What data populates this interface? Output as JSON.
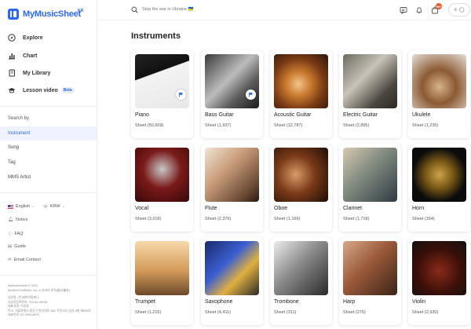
{
  "brand": {
    "name": "MyMusicSheet",
    "region": "KR"
  },
  "nav": [
    {
      "label": "Explore",
      "icon": "compass-icon"
    },
    {
      "label": "Chart",
      "icon": "chart-icon"
    },
    {
      "label": "My Library",
      "icon": "library-icon"
    },
    {
      "label": "Lesson video",
      "icon": "graduation-cap-icon",
      "badge": "Beta"
    }
  ],
  "browse": {
    "heading": "Search by",
    "items": [
      {
        "label": "Instrument",
        "active": true
      },
      {
        "label": "Song",
        "active": false
      },
      {
        "label": "Tag",
        "active": false
      },
      {
        "label": "MMS Artist",
        "active": false
      }
    ]
  },
  "locale": {
    "language": "English",
    "currency": "KRW"
  },
  "links": [
    {
      "label": "Notice",
      "icon": "bell-icon"
    },
    {
      "label": "FAQ",
      "icon": "question-icon"
    },
    {
      "label": "Guide",
      "icon": "book-icon"
    },
    {
      "label": "Email Contact",
      "icon": "envelope-icon"
    }
  ],
  "footer": {
    "lines": [
      "MyMusicSheet © 2023",
      "MAPIACOMPANY, Inc. & 코리아 뮤직(株式會社)",
      "",
      "상호명: (주)마피아컴퍼니",
      "사업자등록번호: 752-81-00236",
      "대표자명: 이승원",
      "주소: 서울특별시 용산구 한강대로 366, 트윈시티 남산 6층 제605호",
      "대표번호: 02-2399-8870"
    ]
  },
  "header": {
    "search_placeholder": "Stop the war in Ukraine 🇺🇦",
    "cart_count": "99+"
  },
  "page": {
    "title": "Instruments"
  },
  "colors": {
    "accent": "#2b67f6",
    "active_bg": "#eef3ff",
    "badge": "#f05a28"
  },
  "instruments": [
    {
      "name": "Piano",
      "count": "Sheet (50,609)",
      "pinned": true
    },
    {
      "name": "Bass Guitar",
      "count": "Sheet (1,937)",
      "pinned": true
    },
    {
      "name": "Acoustic Guitar",
      "count": "Sheet (12,787)",
      "pinned": false
    },
    {
      "name": "Electric Guitar",
      "count": "Sheet (2,895)",
      "pinned": false
    },
    {
      "name": "Ukulele",
      "count": "Sheet (1,235)",
      "pinned": false
    },
    {
      "name": "Vocal",
      "count": "Sheet (3,018)",
      "pinned": false
    },
    {
      "name": "Flute",
      "count": "Sheet (2,376)",
      "pinned": false
    },
    {
      "name": "Oboe",
      "count": "Sheet (1,169)",
      "pinned": false
    },
    {
      "name": "Clarinet",
      "count": "Sheet (1,718)",
      "pinned": false
    },
    {
      "name": "Horn",
      "count": "Sheet (164)",
      "pinned": false
    },
    {
      "name": "Trumpet",
      "count": "Sheet (1,216)",
      "pinned": false
    },
    {
      "name": "Saxophone",
      "count": "Sheet (4,411)",
      "pinned": false
    },
    {
      "name": "Trombone",
      "count": "Sheet (311)",
      "pinned": false
    },
    {
      "name": "Harp",
      "count": "Sheet (276)",
      "pinned": false
    },
    {
      "name": "Violin",
      "count": "Sheet (2,930)",
      "pinned": false
    }
  ]
}
